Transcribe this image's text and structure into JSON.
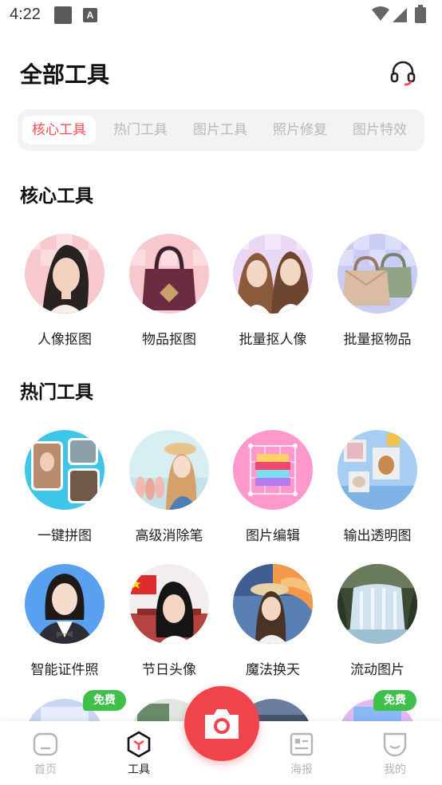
{
  "status_bar": {
    "time": "4:22",
    "notif_letter": "A"
  },
  "header": {
    "title": "全部工具"
  },
  "tabs": [
    {
      "label": "核心工具",
      "active": true
    },
    {
      "label": "热门工具",
      "active": false
    },
    {
      "label": "图片工具",
      "active": false
    },
    {
      "label": "照片修复",
      "active": false
    },
    {
      "label": "图片特效",
      "active": false
    }
  ],
  "sections": {
    "core": {
      "title": "核心工具",
      "tools": [
        {
          "label": "人像抠图"
        },
        {
          "label": "物品抠图"
        },
        {
          "label": "批量抠人像"
        },
        {
          "label": "批量抠物品"
        }
      ]
    },
    "hot": {
      "title": "热门工具",
      "tools": [
        {
          "label": "一键拼图"
        },
        {
          "label": "高级消除笔"
        },
        {
          "label": "图片编辑"
        },
        {
          "label": "输出透明图"
        },
        {
          "label": "智能证件照"
        },
        {
          "label": "节日头像"
        },
        {
          "label": "魔法换天"
        },
        {
          "label": "流动图片"
        }
      ]
    }
  },
  "badges": {
    "free": "免费"
  },
  "bottom_nav": {
    "home": "首页",
    "tools": "工具",
    "poster": "海报",
    "mine": "我的"
  },
  "colors": {
    "accent": "#ff4a55",
    "camera": "#f0444a",
    "free_badge": "#3ec04a"
  }
}
